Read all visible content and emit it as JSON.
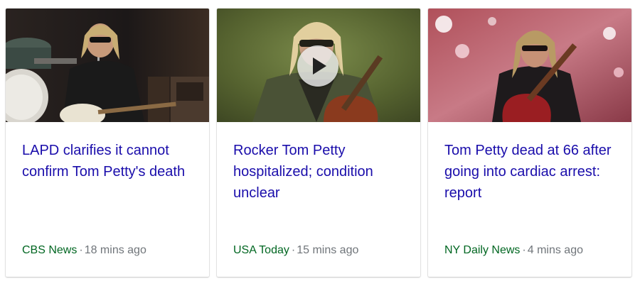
{
  "colors": {
    "headline": "#1a0dab",
    "source": "#006621",
    "meta": "#70757a"
  },
  "separator": "·",
  "cards": [
    {
      "headline": "LAPD clarifies it cannot confirm Tom Petty's death",
      "source": "CBS News",
      "time": "18 mins ago",
      "has_video": false
    },
    {
      "headline": "Rocker Tom Petty hospitalized; condition unclear",
      "source": "USA Today",
      "time": "15 mins ago",
      "has_video": true
    },
    {
      "headline": "Tom Petty dead at 66 after going into cardiac arrest: report",
      "source": "NY Daily News",
      "time": "4 mins ago",
      "has_video": false
    }
  ]
}
